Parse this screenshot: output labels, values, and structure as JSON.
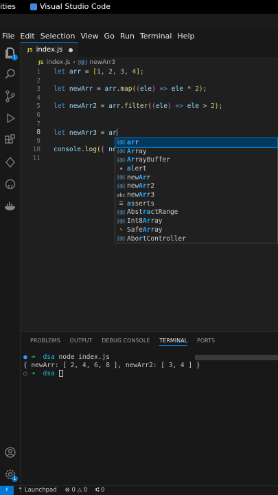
{
  "topbar": {
    "left_label": "ities",
    "app_title": "Visual Studio Code"
  },
  "menu": [
    "File",
    "Edit",
    "Selection",
    "View",
    "Go",
    "Run",
    "Terminal",
    "Help"
  ],
  "activity": {
    "explorer_badge": "1",
    "accounts_badge": "1"
  },
  "tab": {
    "icon": "JS",
    "label": "index.js"
  },
  "breadcrumb": {
    "file": "index.js",
    "symbol_icon": "[@]",
    "symbol": "newArr3"
  },
  "editor": {
    "line_numbers": [
      "1",
      "2",
      "3",
      "4",
      "5",
      "6",
      "7",
      "8",
      "9",
      "10",
      "11"
    ],
    "l1": {
      "kw": "let",
      "name": "arr",
      "eq": " = ",
      "b1": "[",
      "body": "1, 2, 3, 4",
      "b2": "]",
      "end": ";"
    },
    "l3": {
      "kw": "let",
      "name": "newArr",
      "eq": " = ",
      "obj": "arr",
      "dot": ".",
      "fn": "map",
      "p1": "(",
      "p2": "(",
      "param": "ele",
      "p3": ")",
      "arrow": " => ",
      "expr": "ele",
      "op": " * ",
      "num": "2",
      "p4": ")",
      "end": ";"
    },
    "l5": {
      "kw": "let",
      "name": "newArr2",
      "eq": " = ",
      "obj": "arr",
      "dot": ".",
      "fn": "filter",
      "p1": "(",
      "p2": "(",
      "param": "ele",
      "p3": ")",
      "arrow": " => ",
      "expr": "ele",
      "op": " > ",
      "num": "2",
      "p4": ")",
      "end": ";"
    },
    "l8": {
      "kw": "let",
      "name": "newArr3",
      "eq": " = ",
      "typed": "ar"
    },
    "l10": {
      "obj": "console",
      "dot": ".",
      "fn": "log",
      "p1": "(",
      "b1": "{",
      "rest": " ne"
    }
  },
  "suggestions": [
    {
      "icon": "[@]",
      "kind": "var",
      "match": "ar",
      "rest": "r"
    },
    {
      "icon": "[@]",
      "kind": "var",
      "pre": "",
      "match": "Ar",
      "rest": "ray"
    },
    {
      "icon": "[@]",
      "kind": "var",
      "match": "Ar",
      "rest": "rayBuffer"
    },
    {
      "icon": "◆",
      "kind": "fnc",
      "pre": "",
      "match": "a",
      "rest": "lert"
    },
    {
      "icon": "[@]",
      "kind": "var",
      "pre": "new",
      "match": "Ar",
      "rest": "r"
    },
    {
      "icon": "[@]",
      "kind": "var",
      "pre": "new",
      "match": "Ar",
      "rest": "r2"
    },
    {
      "icon": "abc",
      "kind": "kwd",
      "pre": "new",
      "match": "Ar",
      "rest": "r3"
    },
    {
      "icon": "☰",
      "kind": "kwd",
      "pre": "",
      "match": "a",
      "rest": "sserts"
    },
    {
      "icon": "[@]",
      "kind": "var",
      "pre": "Abst",
      "match": "ra",
      "rest": "ctRange"
    },
    {
      "icon": "[@]",
      "kind": "var",
      "pre": "Int8",
      "match": "Ar",
      "rest": "ray"
    },
    {
      "icon": "✎",
      "kind": "cls",
      "pre": "Safe",
      "match": "Ar",
      "rest": "ray"
    },
    {
      "icon": "[@]",
      "kind": "var",
      "pre": "Abo",
      "match": "r",
      "rest": "tController"
    }
  ],
  "panel": {
    "tabs": [
      "PROBLEMS",
      "OUTPUT",
      "DEBUG CONSOLE",
      "TERMINAL",
      "PORTS"
    ],
    "active_tab": "TERMINAL"
  },
  "terminal": {
    "line1": {
      "bullet": "●",
      "arrow": "➜",
      "path": "dsa",
      "cmd": " node index.js"
    },
    "line2": {
      "a": "{ newArr: [ ",
      "n1": "2",
      "c1": ", ",
      "n2": "4",
      "c2": ", ",
      "n3": "6",
      "c3": ", ",
      "n4": "8",
      "b": " ], newArr2: [ ",
      "n5": "3",
      "c4": ", ",
      "n6": "4",
      "end": " ] }"
    },
    "line3": {
      "bullet": "○",
      "arrow": "➜",
      "path": "dsa"
    }
  },
  "status": {
    "remote": "⚡",
    "launchpad": "Launchpad",
    "errors": "0",
    "warnings": "0",
    "ports": "0"
  }
}
